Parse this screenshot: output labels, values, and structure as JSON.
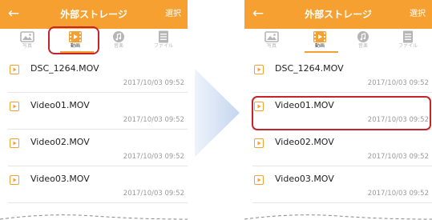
{
  "colors": {
    "accent": "#f5a031",
    "highlight": "#c4242a",
    "arrow": "#c5d6ef"
  },
  "screens": [
    {
      "header": {
        "back_icon": "left-arrow-icon",
        "title": "外部ストレージ",
        "select_label": "選択"
      },
      "tabs": [
        {
          "label": "写真",
          "icon": "image-icon",
          "active": false
        },
        {
          "label": "動画",
          "icon": "film-icon",
          "active": true
        },
        {
          "label": "音楽",
          "icon": "music-icon",
          "active": false
        },
        {
          "label": "ファイル",
          "icon": "document-icon",
          "active": false
        }
      ],
      "files": [
        {
          "name": "DSC_1264.MOV",
          "time": "2017/10/03 09:52"
        },
        {
          "name": "Video01.MOV",
          "time": "2017/10/03 09:52"
        },
        {
          "name": "Video02.MOV",
          "time": "2017/10/03 09:52"
        },
        {
          "name": "Video03.MOV",
          "time": "2017/10/03 09:52"
        }
      ]
    },
    {
      "header": {
        "back_icon": "left-arrow-icon",
        "title": "外部ストレージ",
        "select_label": "選択"
      },
      "tabs": [
        {
          "label": "写真",
          "icon": "image-icon",
          "active": false
        },
        {
          "label": "動画",
          "icon": "film-icon",
          "active": true
        },
        {
          "label": "音楽",
          "icon": "music-icon",
          "active": false
        },
        {
          "label": "ファイル",
          "icon": "document-icon",
          "active": false
        }
      ],
      "files": [
        {
          "name": "DSC_1264.MOV",
          "time": "2017/10/03 09:52"
        },
        {
          "name": "Video01.MOV",
          "time": "2017/10/03 09:52"
        },
        {
          "name": "Video02.MOV",
          "time": "2017/10/03 09:52"
        },
        {
          "name": "Video03.MOV",
          "time": "2017/10/03 09:52"
        }
      ]
    }
  ]
}
